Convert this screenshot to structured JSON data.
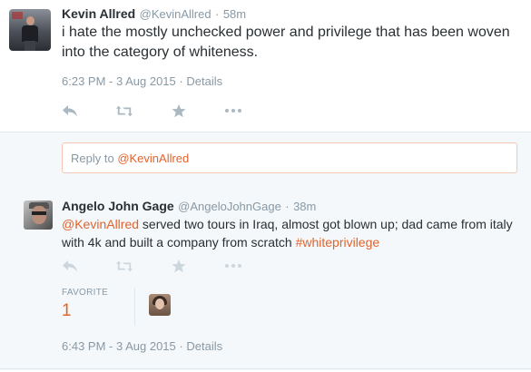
{
  "tweet1": {
    "name": "Kevin Allred",
    "handle": "@KevinAllred",
    "separator": "·",
    "age": "58m",
    "text": "i hate the mostly unchecked power and privilege that has been woven into the category of whiteness.",
    "timestamp": "6:23 PM - 3 Aug 2015",
    "details_label": "Details"
  },
  "reply": {
    "prefix": "Reply to ",
    "mention": "@KevinAllred"
  },
  "tweet2": {
    "name": "Angelo John Gage",
    "handle": "@AngeloJohnGage",
    "separator": "·",
    "age": "38m",
    "text_mention": "@KevinAllred",
    "text_body": " served two tours in Iraq, almost got blown up; dad came from italy with 4k and built a company from scratch ",
    "text_hashtag": "#whiteprivilege",
    "favorite_label": "FAVORITE",
    "favorite_count": "1",
    "timestamp": "6:43 PM - 3 Aug 2015",
    "details_label": "Details"
  },
  "icons": [
    "reply-icon",
    "retweet-icon",
    "favorite-star-icon",
    "more-dots-icon"
  ],
  "colors": {
    "accent": "#e0642f",
    "muted": "#8899a6",
    "text": "#292f33",
    "background_alt": "#f5f8fa",
    "border": "#e1e8ed"
  }
}
